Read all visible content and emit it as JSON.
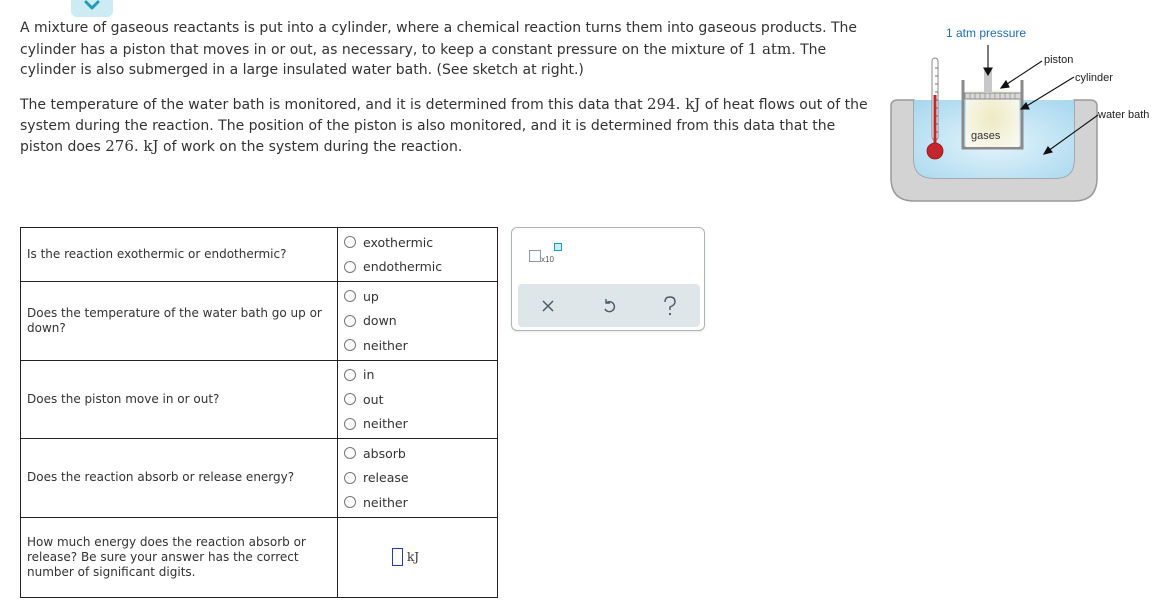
{
  "problem": {
    "paragraph1": [
      {
        "t": "A mixture of gaseous reactants is put into a cylinder, where a chemical reaction turns them into gaseous products. The cylinder has a piston that moves in or out, as necessary, to keep a constant pressure on the mixture of "
      },
      {
        "m": "1 atm"
      },
      {
        "t": ". The cylinder is also submerged in a large insulated water bath. (See sketch at right.)"
      }
    ],
    "paragraph2": [
      {
        "t": "The temperature of the water bath is monitored, and it is determined from this data that "
      },
      {
        "m": "294. kJ"
      },
      {
        "t": " of heat flows out of the system during the reaction. The position of the piston is also monitored, and it is determined from this data that the piston does "
      },
      {
        "m": "276. kJ"
      },
      {
        "t": " of work on the system during the reaction."
      }
    ]
  },
  "figure": {
    "pressure_label": "1 atm pressure",
    "piston_label": "piston",
    "cylinder_label": "cylinder",
    "water_bath_label": "water bath",
    "gases_label": "gases"
  },
  "questions": [
    {
      "prompt": "Is the reaction exothermic or endothermic?",
      "options": [
        "exothermic",
        "endothermic"
      ]
    },
    {
      "prompt": "Does the temperature of the water bath go up or down?",
      "options": [
        "up",
        "down",
        "neither"
      ]
    },
    {
      "prompt": "Does the piston move in or out?",
      "options": [
        "in",
        "out",
        "neither"
      ]
    },
    {
      "prompt": "Does the reaction absorb or release energy?",
      "options": [
        "absorb",
        "release",
        "neither"
      ]
    },
    {
      "prompt": "How much energy does the reaction absorb or release? Be sure your answer has the correct number of significant digits.",
      "answer_value": "",
      "answer_unit": "kJ"
    }
  ],
  "tools": {
    "sci_notation_label": "x10",
    "clear_icon": "close-icon",
    "undo_icon": "undo-icon",
    "help_icon": "help-icon"
  },
  "colors": {
    "accent": "#1f9bbd",
    "toolbar_bg": "#dfe6e9",
    "input_border": "#1d39d6"
  }
}
